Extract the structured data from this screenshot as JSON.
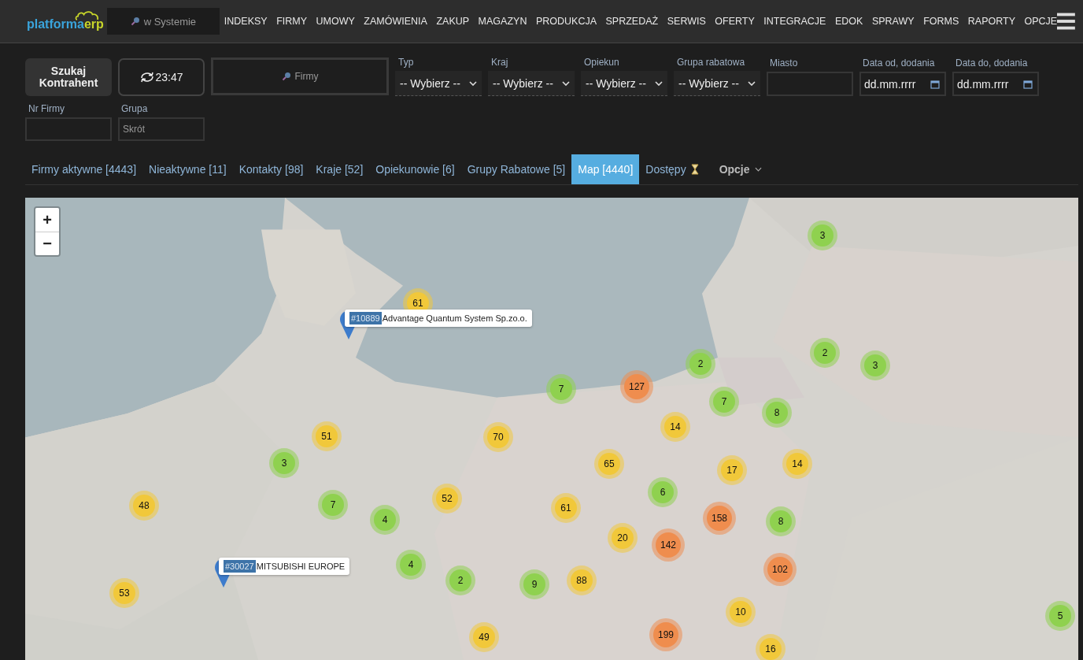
{
  "header": {
    "logo": {
      "part1": "platforma",
      "part2": "erp"
    },
    "search": {
      "placeholder": "w Systemie"
    },
    "nav": [
      "INDEKSY",
      "FIRMY",
      "UMOWY",
      "ZAMÓWIENIA",
      "ZAKUP",
      "MAGAZYN",
      "PRODUKCJA",
      "SPRZEDAŻ",
      "SERWIS",
      "OFERTY",
      "INTEGRACJE",
      "EDOK",
      "SPRAWY",
      "FORMS",
      "RAPORTY",
      "OPCJE"
    ]
  },
  "filters": {
    "search_button": "Szukaj Kontrahent",
    "refresh_button": "23:47",
    "firms_search": {
      "placeholder": "Firmy"
    },
    "fields": [
      {
        "label": "Typ",
        "kind": "select",
        "value": "-- Wybierz --"
      },
      {
        "label": "Kraj",
        "kind": "select",
        "value": "-- Wybierz --"
      },
      {
        "label": "Opiekun",
        "kind": "select",
        "value": "-- Wybierz --"
      },
      {
        "label": "Grupa rabatowa",
        "kind": "select",
        "value": "-- Wybierz --"
      },
      {
        "label": "Miasto",
        "kind": "text"
      },
      {
        "label": "Data od, dodania",
        "kind": "date",
        "value": "dd.mm.rrrr"
      },
      {
        "label": "Data do, dodania",
        "kind": "date",
        "value": "dd.mm.rrrr"
      }
    ],
    "row2": [
      {
        "label": "Nr Firmy"
      },
      {
        "label": "Grupa",
        "placeholder": "Skrót"
      }
    ]
  },
  "tabs": [
    {
      "label": "Firmy aktywne [4443]",
      "kind": "tab",
      "selected": false
    },
    {
      "label": "Nieaktywne [11]",
      "kind": "tab",
      "selected": false
    },
    {
      "label": "Kontakty [98]",
      "kind": "tab",
      "selected": false
    },
    {
      "label": "Kraje [52]",
      "kind": "tab",
      "selected": false
    },
    {
      "label": "Opiekunowie [6]",
      "kind": "tab",
      "selected": false
    },
    {
      "label": "Grupy Rabatowe [5]",
      "kind": "tab",
      "selected": false
    },
    {
      "label": "Map [4440]",
      "kind": "tab",
      "selected": true
    },
    {
      "label": "Dostępy",
      "kind": "pending",
      "selected": false
    },
    {
      "label": "Opcje",
      "kind": "dropdown",
      "selected": false
    }
  ],
  "map": {
    "zoom_in": "+",
    "zoom_out": "−",
    "clusters": [
      {
        "count": "3",
        "color": "#8fd14f"
      },
      {
        "count": "61",
        "color": "#f1c83a"
      },
      {
        "count": "2",
        "color": "#8fd14f"
      },
      {
        "count": "2",
        "color": "#8fd14f"
      },
      {
        "count": "3",
        "color": "#8fd14f"
      },
      {
        "count": "7",
        "color": "#8fd14f"
      },
      {
        "count": "127",
        "color": "#ef8d4e"
      },
      {
        "count": "7",
        "color": "#8fd14f"
      },
      {
        "count": "8",
        "color": "#8fd14f"
      },
      {
        "count": "14",
        "color": "#f1c83a"
      },
      {
        "count": "51",
        "color": "#f1c83a"
      },
      {
        "count": "70",
        "color": "#f1c83a"
      },
      {
        "count": "3",
        "color": "#8fd14f"
      },
      {
        "count": "65",
        "color": "#f1c83a"
      },
      {
        "count": "17",
        "color": "#f1c83a"
      },
      {
        "count": "14",
        "color": "#f1c83a"
      },
      {
        "count": "6",
        "color": "#8fd14f"
      },
      {
        "count": "48",
        "color": "#f1c83a"
      },
      {
        "count": "7",
        "color": "#8fd14f"
      },
      {
        "count": "52",
        "color": "#f1c83a"
      },
      {
        "count": "61",
        "color": "#f1c83a"
      },
      {
        "count": "4",
        "color": "#8fd14f"
      },
      {
        "count": "158",
        "color": "#ef8d4e"
      },
      {
        "count": "8",
        "color": "#8fd14f"
      },
      {
        "count": "20",
        "color": "#f1c83a"
      },
      {
        "count": "142",
        "color": "#ef8d4e"
      },
      {
        "count": "4",
        "color": "#8fd14f"
      },
      {
        "count": "102",
        "color": "#ef8d4e"
      },
      {
        "count": "53",
        "color": "#f1c83a"
      },
      {
        "count": "2",
        "color": "#8fd14f"
      },
      {
        "count": "9",
        "color": "#8fd14f"
      },
      {
        "count": "88",
        "color": "#f1c83a"
      },
      {
        "count": "10",
        "color": "#f1c83a"
      },
      {
        "count": "5",
        "color": "#8fd14f"
      },
      {
        "count": "49",
        "color": "#f1c83a"
      },
      {
        "count": "199",
        "color": "#ef8d4e"
      },
      {
        "count": "16",
        "color": "#f1c83a"
      }
    ],
    "pins": [
      {
        "id": "#10889",
        "name": "Advantage Quantum System Sp.zo.o."
      },
      {
        "id": "#30027",
        "name": "MITSUBISHI EUROPE"
      }
    ]
  }
}
